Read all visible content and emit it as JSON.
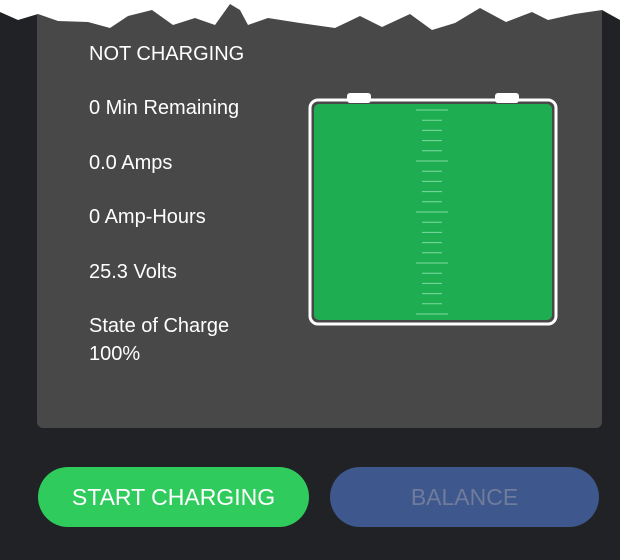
{
  "status": {
    "charging_state": "NOT CHARGING",
    "time_remaining": "0 Min Remaining",
    "current": "0.0 Amps",
    "capacity": "0 Amp-Hours",
    "voltage": "25.3 Volts",
    "state_of_charge_label": "State of Charge\n100%"
  },
  "battery": {
    "charge_fraction": 1.0,
    "fill_color": "#1fad51",
    "outline_color": "#ffffff"
  },
  "actions": {
    "start_label": "START CHARGING",
    "balance_label": "BALANCE",
    "start_color": "#2fcc5d",
    "balance_color": "#3e578c"
  },
  "colors": {
    "background": "#212226",
    "card": "#484848"
  }
}
